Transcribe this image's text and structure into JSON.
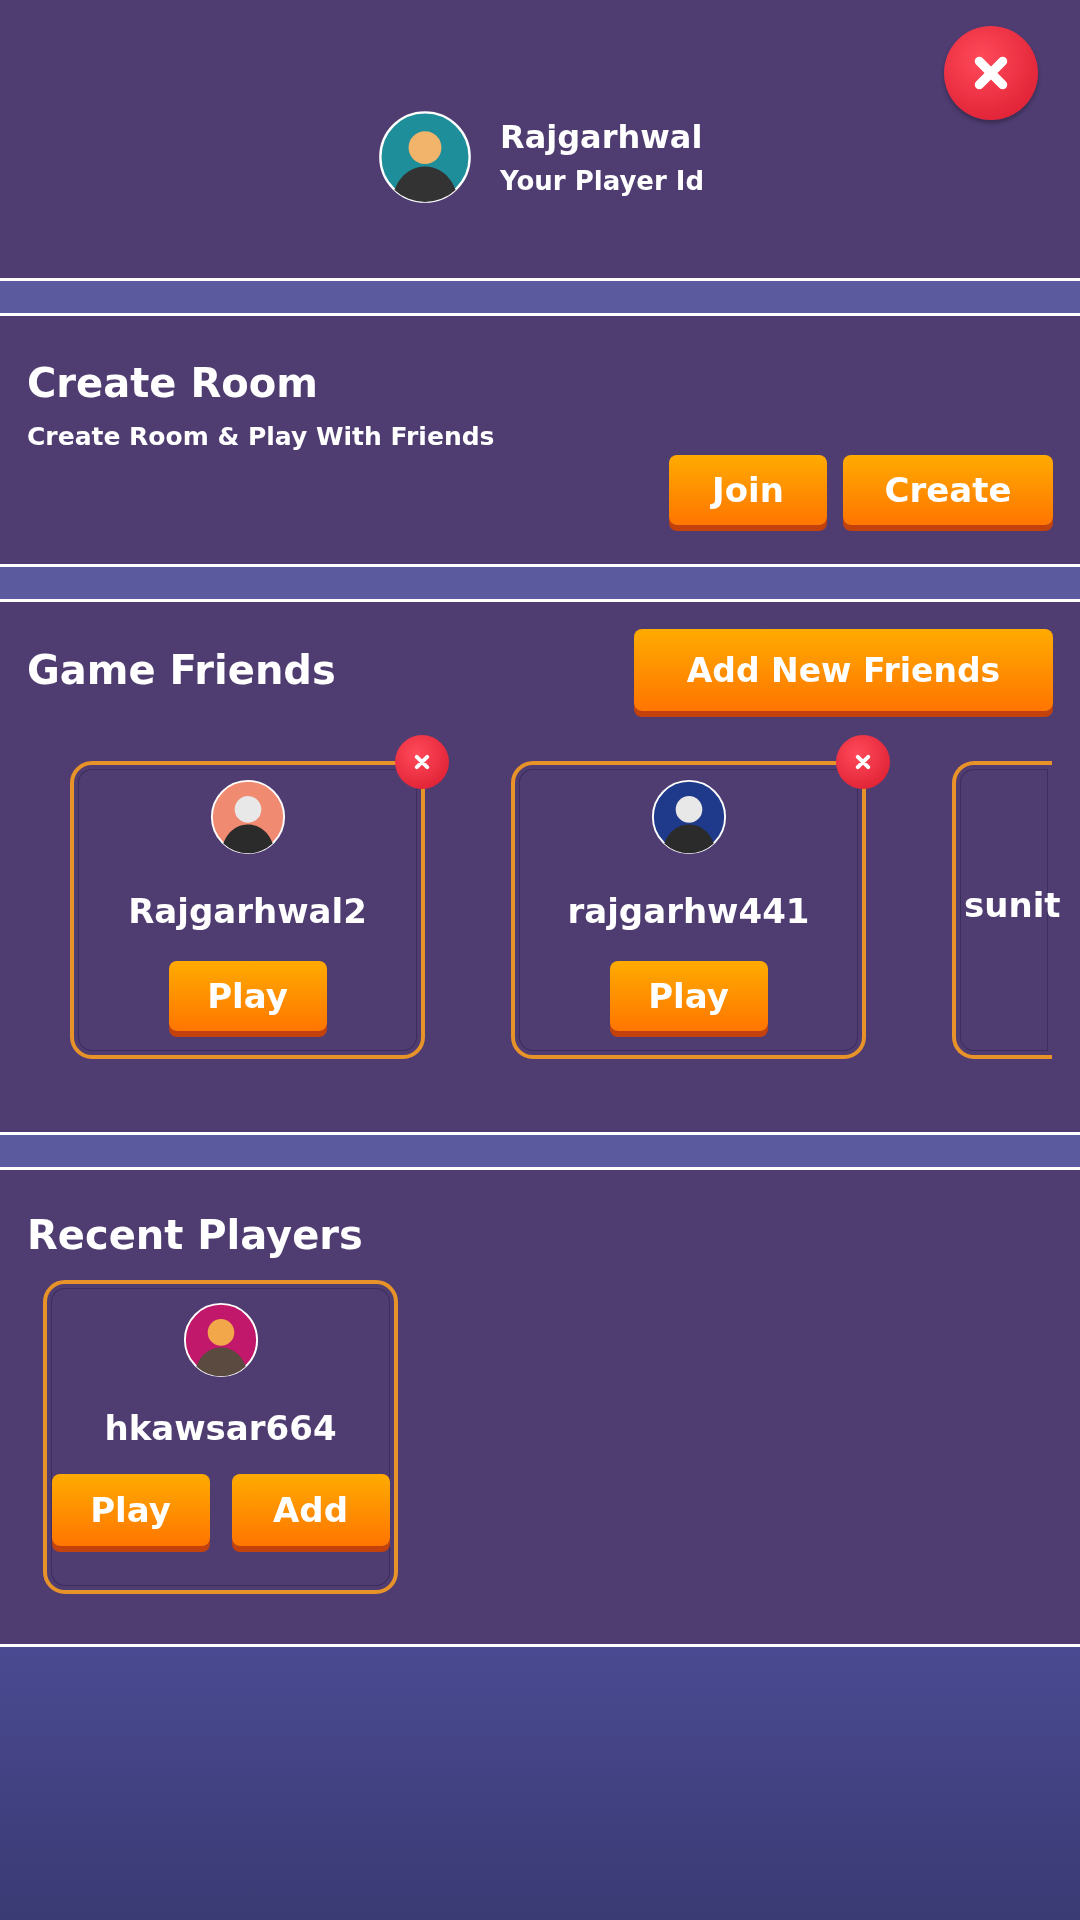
{
  "profile": {
    "name": "Rajgarhwal",
    "subtitle": "Your Player Id"
  },
  "create_room": {
    "title": "Create Room",
    "subtitle": "Create Room & Play With Friends",
    "buttons": [
      "Join",
      "Create"
    ]
  },
  "game_friends": {
    "title": "Game Friends",
    "add_button": "Add New Friends",
    "friends": [
      {
        "kind": "full",
        "name": "Rajgarhwal2",
        "button": "Play"
      },
      {
        "kind": "full",
        "name": "rajgarhw441",
        "button": "Play"
      },
      {
        "kind": "cut",
        "name": "sunit"
      }
    ]
  },
  "recent_players": {
    "title": "Recent Players",
    "players": [
      {
        "name": "hkawsar664",
        "buttons": [
          "Play",
          "Add"
        ]
      }
    ]
  }
}
